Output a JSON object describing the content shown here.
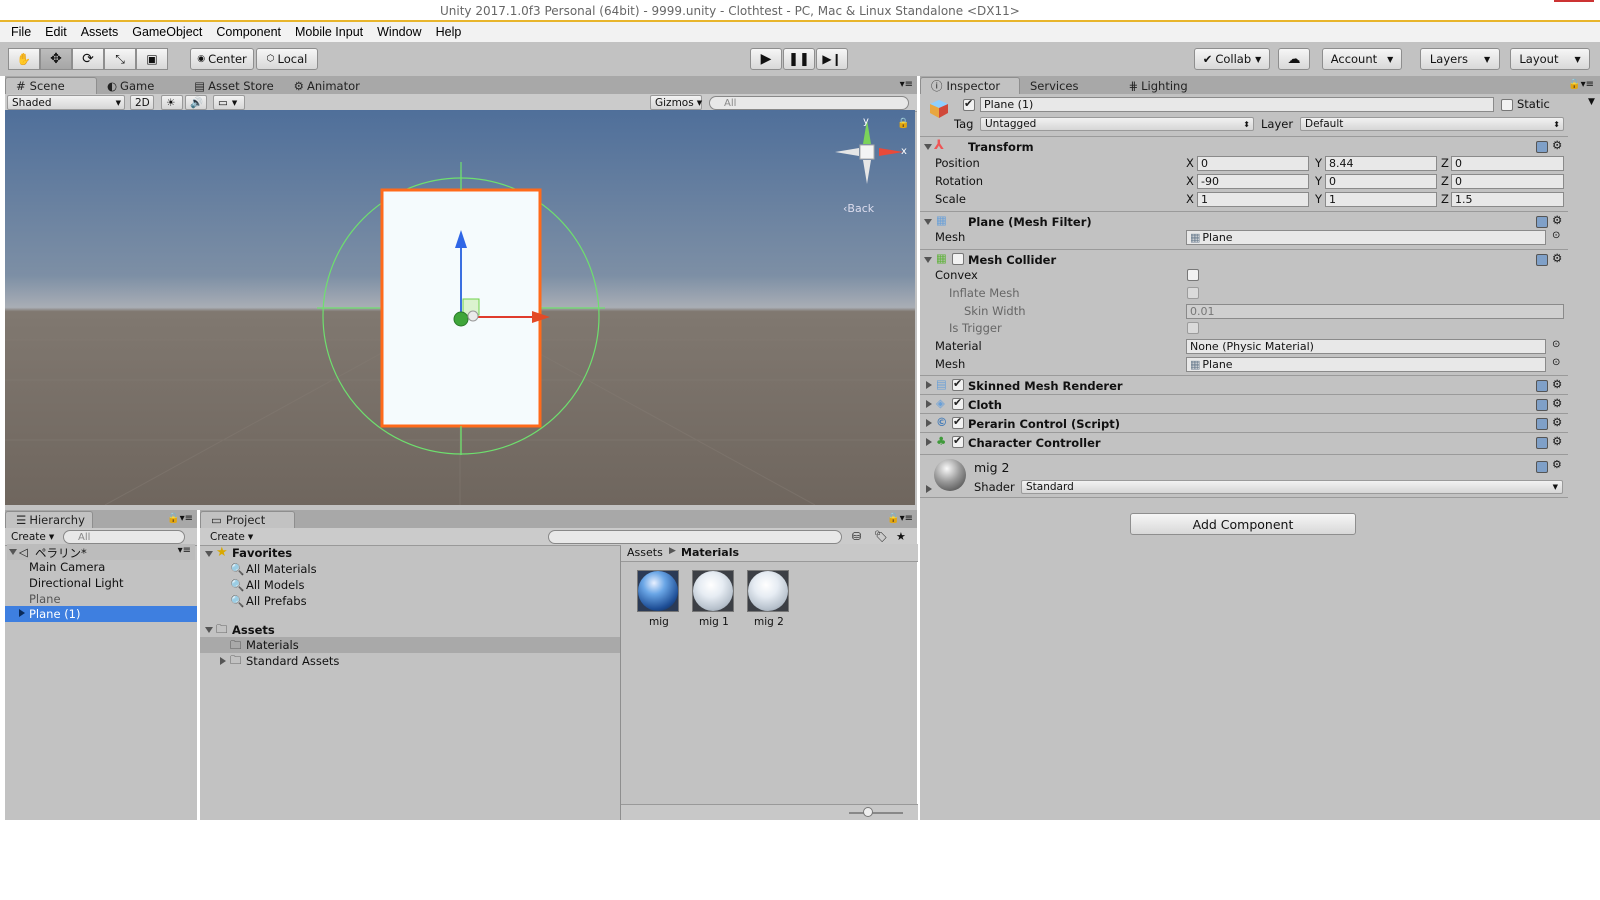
{
  "window": {
    "title_partial": "Unity 2017.1.0f3 Personal (64bit) - 9999.unity - Clothtest - PC, Mac & Linux Standalone <DX11>"
  },
  "menu": [
    "File",
    "Edit",
    "Assets",
    "GameObject",
    "Component",
    "Mobile Input",
    "Window",
    "Help"
  ],
  "toolbar": {
    "pivot_label": "Center",
    "space_label": "Local",
    "collab_label": "Collab",
    "account_label": "Account",
    "layers_label": "Layers",
    "layout_label": "Layout"
  },
  "scene_tabs": [
    "Scene",
    "Game",
    "Asset Store",
    "Animator"
  ],
  "scene_bar": {
    "shading": "Shaded",
    "mode2d": "2D",
    "gizmos": "Gizmos",
    "search_placeholder": "All"
  },
  "gizmo": {
    "y_label": "y",
    "x_label": "x",
    "back_label": "Back"
  },
  "inspector_tabs": [
    "Inspector",
    "Services",
    "Lighting"
  ],
  "inspector": {
    "object_name": "Plane (1)",
    "static_label": "Static",
    "tag_label": "Tag",
    "tag_value": "Untagged",
    "layer_label": "Layer",
    "layer_value": "Default",
    "transform": {
      "title": "Transform",
      "position_label": "Position",
      "rotation_label": "Rotation",
      "scale_label": "Scale",
      "axis_x": "X",
      "axis_y": "Y",
      "axis_z": "Z",
      "position": {
        "x": "0",
        "y": "8.44",
        "z": "0"
      },
      "rotation": {
        "x": "-90",
        "y": "0",
        "z": "0"
      },
      "scale": {
        "x": "1",
        "y": "1",
        "z": "1.5"
      }
    },
    "mesh_filter": {
      "title": "Plane (Mesh Filter)",
      "mesh_label": "Mesh",
      "mesh_value": "Plane"
    },
    "mesh_collider": {
      "title": "Mesh Collider",
      "convex_label": "Convex",
      "inflate_label": "Inflate Mesh",
      "skin_label": "Skin Width",
      "skin_value": "0.01",
      "trigger_label": "Is Trigger",
      "material_label": "Material",
      "material_value": "None (Physic Material)",
      "mesh_label": "Mesh",
      "mesh_value": "Plane"
    },
    "components": [
      "Skinned Mesh Renderer",
      "Cloth",
      "Perarin Control (Script)",
      "Character Controller"
    ],
    "material": {
      "name": "mig 2",
      "shader_label": "Shader",
      "shader_value": "Standard"
    },
    "add_component": "Add Component"
  },
  "hierarchy": {
    "tab": "Hierarchy",
    "create": "Create",
    "search_placeholder": "All",
    "scene_name": "ペラリン*",
    "items": [
      "Main Camera",
      "Directional Light",
      "Plane",
      "Plane (1)"
    ]
  },
  "project": {
    "tab": "Project",
    "create": "Create",
    "favorites": "Favorites",
    "fav_items": [
      "All Materials",
      "All Models",
      "All Prefabs"
    ],
    "assets": "Assets",
    "asset_items": [
      "Materials",
      "Standard Assets"
    ],
    "breadcrumb_root": "Assets",
    "breadcrumb_current": "Materials",
    "materials": [
      "mig",
      "mig 1",
      "mig 2"
    ]
  },
  "colors": {
    "selection": "#3e7fe0",
    "panel": "#c2c2c2",
    "orange_outline": "#ff6a1a"
  }
}
